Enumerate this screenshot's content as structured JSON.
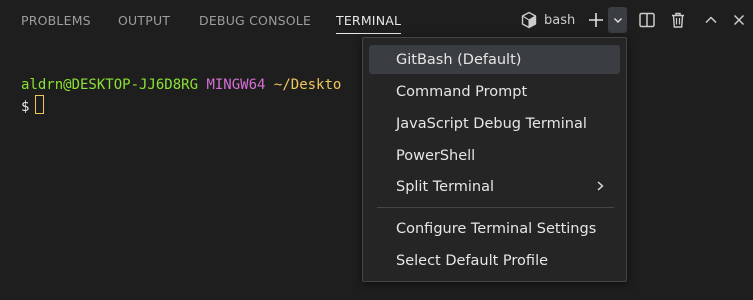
{
  "tabs": [
    {
      "label": "PROBLEMS"
    },
    {
      "label": "OUTPUT"
    },
    {
      "label": "DEBUG CONSOLE"
    },
    {
      "label": "TERMINAL",
      "active": true
    }
  ],
  "toolbar": {
    "shell_name": "bash",
    "icons": [
      "terminal-shell-icon",
      "plus-icon",
      "chevron-down-icon",
      "split-icon",
      "trash-icon",
      "chevron-up-icon",
      "close-icon"
    ]
  },
  "terminal": {
    "user": "aldrn@DESKTOP-JJ6D8RG",
    "system": "MINGW64",
    "path": "~/Deskto",
    "prompt": "$"
  },
  "menu": {
    "items": [
      {
        "label": "GitBash (Default)"
      },
      {
        "label": "Command Prompt"
      },
      {
        "label": "JavaScript Debug Terminal"
      },
      {
        "label": "PowerShell"
      },
      {
        "label": "Split Terminal",
        "has_submenu": true
      },
      {
        "label": "Configure Terminal Settings"
      },
      {
        "label": "Select Default Profile"
      }
    ]
  },
  "colors": {
    "background": "#1e1e1e",
    "menu_background": "#252526",
    "user": "#8ae234",
    "system": "#d670d6",
    "path": "#f1c75a"
  }
}
